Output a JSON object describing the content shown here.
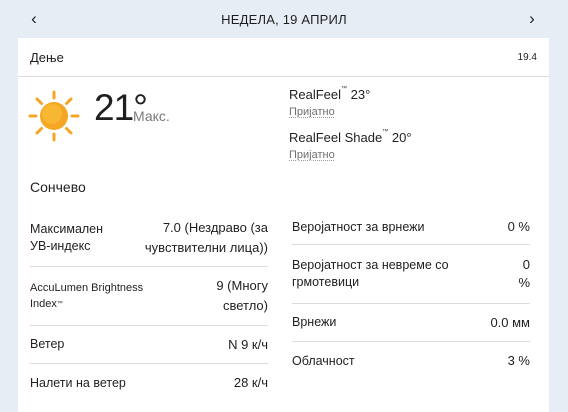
{
  "nav": {
    "title": "НЕДЕЛА, 19 АПРИЛ",
    "prev_icon": "chevron-left-icon",
    "next_icon": "chevron-right-icon"
  },
  "header": {
    "period": "Дење",
    "date_short": "19.4"
  },
  "current": {
    "icon": "sun-icon",
    "temperature": "21°",
    "temperature_label": "Макс.",
    "realfeel_name": "RealFeel",
    "realfeel_value": "23°",
    "realfeel_phrase": "Пријатно",
    "realfeel_shade_name": "RealFeel Shade",
    "realfeel_shade_value": "20°",
    "realfeel_shade_phrase": "Пријатно",
    "tm": "™"
  },
  "phrase": "Сончево",
  "details_left": [
    {
      "label": "Максимален УВ-индекс",
      "value": "7.0 (Нездраво (за чувствителни лица))"
    },
    {
      "label": "AccuLumen Brightness Index",
      "value": "9 (Многу светло)"
    },
    {
      "label": "Ветер",
      "value": "N 9 к/ч"
    },
    {
      "label": "Налети на ветер",
      "value": "28 к/ч"
    }
  ],
  "details_right": [
    {
      "label": "Веројатност за врнежи",
      "value": "0 %"
    },
    {
      "label": "Веројатност за невреме со грмотевици",
      "value": "0 %"
    },
    {
      "label": "Врнежи",
      "value": "0.0 мм"
    },
    {
      "label": "Облачност",
      "value": "3 %"
    }
  ],
  "colors": {
    "page_background": "#e7edf5",
    "card_background": "#ffffff",
    "sun_outer": "#f5a623",
    "sun_inner": "#f7b733",
    "muted_text": "#7a7a7a"
  }
}
